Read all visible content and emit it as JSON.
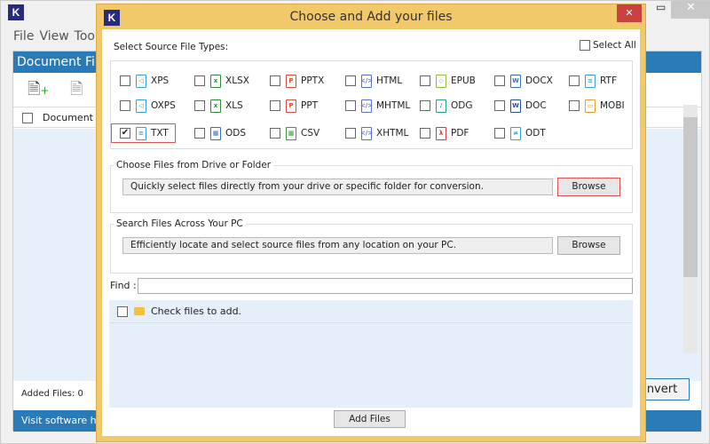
{
  "main_window": {
    "logo": "K",
    "menu": [
      "File",
      "View",
      "Tool"
    ],
    "panel_title": "Document File",
    "column_header": "Document F",
    "added_files": "Added Files: 0",
    "footer": "Visit software hon",
    "convert_label": "nvert"
  },
  "dialog": {
    "logo": "K",
    "title": "Choose and Add your files",
    "close": "✕",
    "select_types_label": "Select Source File Types:",
    "select_all_label": "Select All",
    "file_types": [
      {
        "label": "XPS",
        "color": "#3aa0d8",
        "glyph": "◁",
        "checked": false
      },
      {
        "label": "XLSX",
        "color": "#2e8b3a",
        "glyph": "x",
        "checked": false
      },
      {
        "label": "PPTX",
        "color": "#d4503a",
        "glyph": "P",
        "checked": false
      },
      {
        "label": "HTML",
        "color": "#5a6fd0",
        "glyph": "</>",
        "checked": false
      },
      {
        "label": "EPUB",
        "color": "#8cba3a",
        "glyph": "◇",
        "checked": false
      },
      {
        "label": "DOCX",
        "color": "#3a6fc8",
        "glyph": "W",
        "checked": false
      },
      {
        "label": "RTF",
        "color": "#3aa0d8",
        "glyph": "≡",
        "checked": false
      },
      {
        "label": "OXPS",
        "color": "#3aa0d8",
        "glyph": "◁",
        "checked": false
      },
      {
        "label": "XLS",
        "color": "#2e8b3a",
        "glyph": "x",
        "checked": false
      },
      {
        "label": "PPT",
        "color": "#d4503a",
        "glyph": "P",
        "checked": false
      },
      {
        "label": "MHTML",
        "color": "#5a6fd0",
        "glyph": "</>",
        "checked": false
      },
      {
        "label": "ODG",
        "color": "#2aa08a",
        "glyph": "/",
        "checked": false
      },
      {
        "label": "DOC",
        "color": "#2a4f9a",
        "glyph": "W",
        "checked": false
      },
      {
        "label": "MOBI",
        "color": "#e8a030",
        "glyph": "▭",
        "checked": false
      },
      {
        "label": "TXT",
        "color": "#3aa0d8",
        "glyph": "≡",
        "checked": true
      },
      {
        "label": "ODS",
        "color": "#3a6fc8",
        "glyph": "▦",
        "checked": false
      },
      {
        "label": "CSV",
        "color": "#3a9a3a",
        "glyph": "▦",
        "checked": false
      },
      {
        "label": "XHTML",
        "color": "#5a6fd0",
        "glyph": "</>",
        "checked": false
      },
      {
        "label": "PDF",
        "color": "#d43a3a",
        "glyph": "λ",
        "checked": false
      },
      {
        "label": "ODT",
        "color": "#3aa0d8",
        "glyph": "≠",
        "checked": false
      }
    ],
    "drive_group": {
      "title": "Choose Files from Drive or Folder",
      "text": "Quickly select files directly from your drive or specific folder for conversion.",
      "button": "Browse"
    },
    "search_group": {
      "title": "Search Files Across Your PC",
      "text": "Efficiently locate and select source files from any location on your PC.",
      "button": "Browse"
    },
    "find_label": "Find :",
    "find_value": "",
    "list_header": "Check files to add.",
    "add_button": "Add Files"
  },
  "colors": {
    "dialog_frame": "#f1c86a",
    "accent_blue": "#2a7ab8",
    "close_red": "#c9413f",
    "highlight_red": "#d9534f"
  }
}
